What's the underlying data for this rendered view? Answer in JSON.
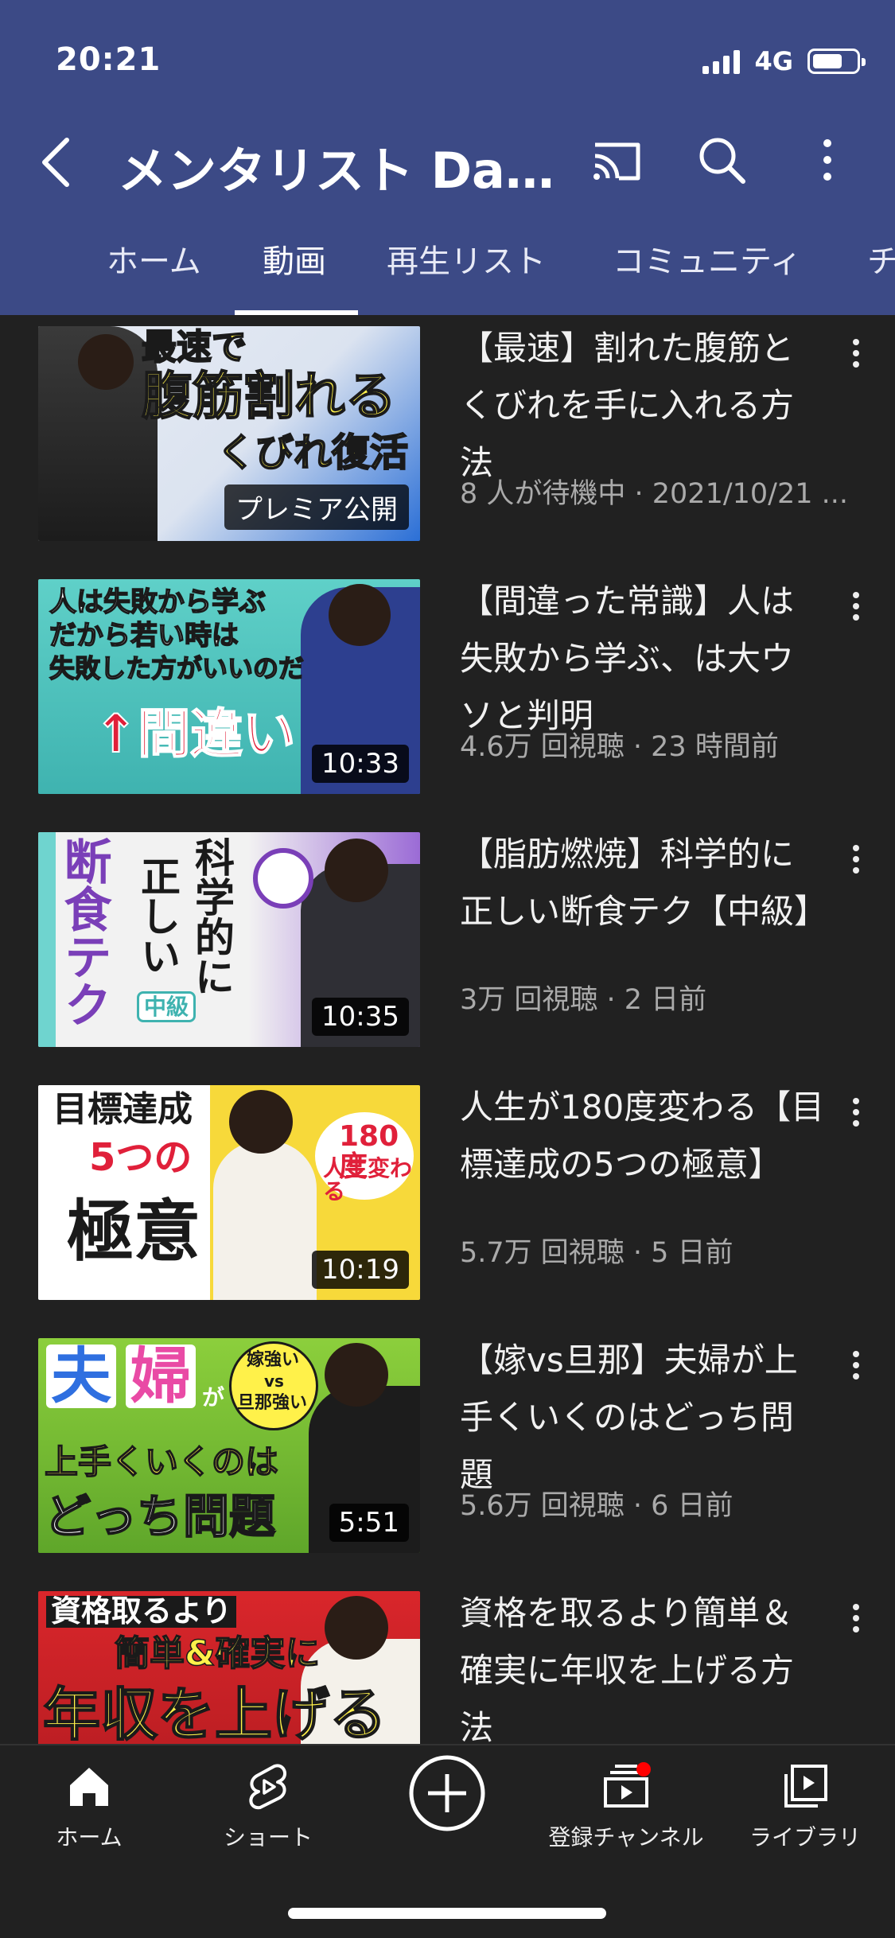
{
  "status_bar": {
    "time": "20:21",
    "network": "4G"
  },
  "toolbar": {
    "channel_title": "メンタリスト Dai..."
  },
  "tabs": [
    {
      "label": "ホーム"
    },
    {
      "label": "動画"
    },
    {
      "label": "再生リスト"
    },
    {
      "label": "コミュニティ"
    },
    {
      "label": "チ"
    }
  ],
  "active_tab": "動画",
  "videos": [
    {
      "title": "【最速】割れた腹筋とくびれを手に入れる方法",
      "meta": "8 人が待機中 · 2021/10/21 ...",
      "badge": "プレミア公開",
      "thumb_text": [
        "最速で",
        "腹筋割れる",
        "くびれ復活"
      ]
    },
    {
      "title": "【間違った常識】人は失敗から学ぶ、は大ウソと判明",
      "meta": "4.6万 回視聴 · 23 時間前",
      "duration": "10:33",
      "thumb_text": [
        "人は失敗から学ぶ",
        "だから若い時は",
        "失敗した方がいいのだ",
        "↑間違い"
      ]
    },
    {
      "title": "【脂肪燃焼】科学的に正しい断食テク【中級】",
      "meta": "3万 回視聴 · 2 日前",
      "duration": "10:35",
      "thumb_text": [
        "断食テク",
        "科学的に",
        "正しい",
        "中級"
      ]
    },
    {
      "title": "人生が180度変わる【目標達成の5つの極意】",
      "meta": "5.7万 回視聴 · 5 日前",
      "duration": "10:19",
      "thumb_text": [
        "目標達成",
        "5つの",
        "極意",
        "180度",
        "人生変わる"
      ]
    },
    {
      "title": "【嫁vs旦那】夫婦が上手くいくのはどっち問題",
      "meta": "5.6万 回視聴 · 6 日前",
      "duration": "5:51",
      "thumb_text": [
        "夫",
        "婦",
        "が",
        "嫁強い",
        "vs",
        "旦那強い",
        "上手くいくのは",
        "どっち問題"
      ]
    },
    {
      "title": "資格を取るより簡単＆確実に年収を上げる方法",
      "meta": "",
      "thumb_text": [
        "資格取るより",
        "簡単&確実に",
        "年収を上げる"
      ]
    }
  ],
  "bottom_nav": [
    {
      "label": "ホーム",
      "icon": "home-icon"
    },
    {
      "label": "ショート",
      "icon": "shorts-icon"
    },
    {
      "label": "",
      "icon": "create-icon"
    },
    {
      "label": "登録チャンネル",
      "icon": "subscriptions-icon"
    },
    {
      "label": "ライブラリ",
      "icon": "library-icon"
    }
  ],
  "colors": {
    "header_bg": "#3c4a86",
    "content_bg": "#212121",
    "notification_dot": "#ff0000"
  }
}
